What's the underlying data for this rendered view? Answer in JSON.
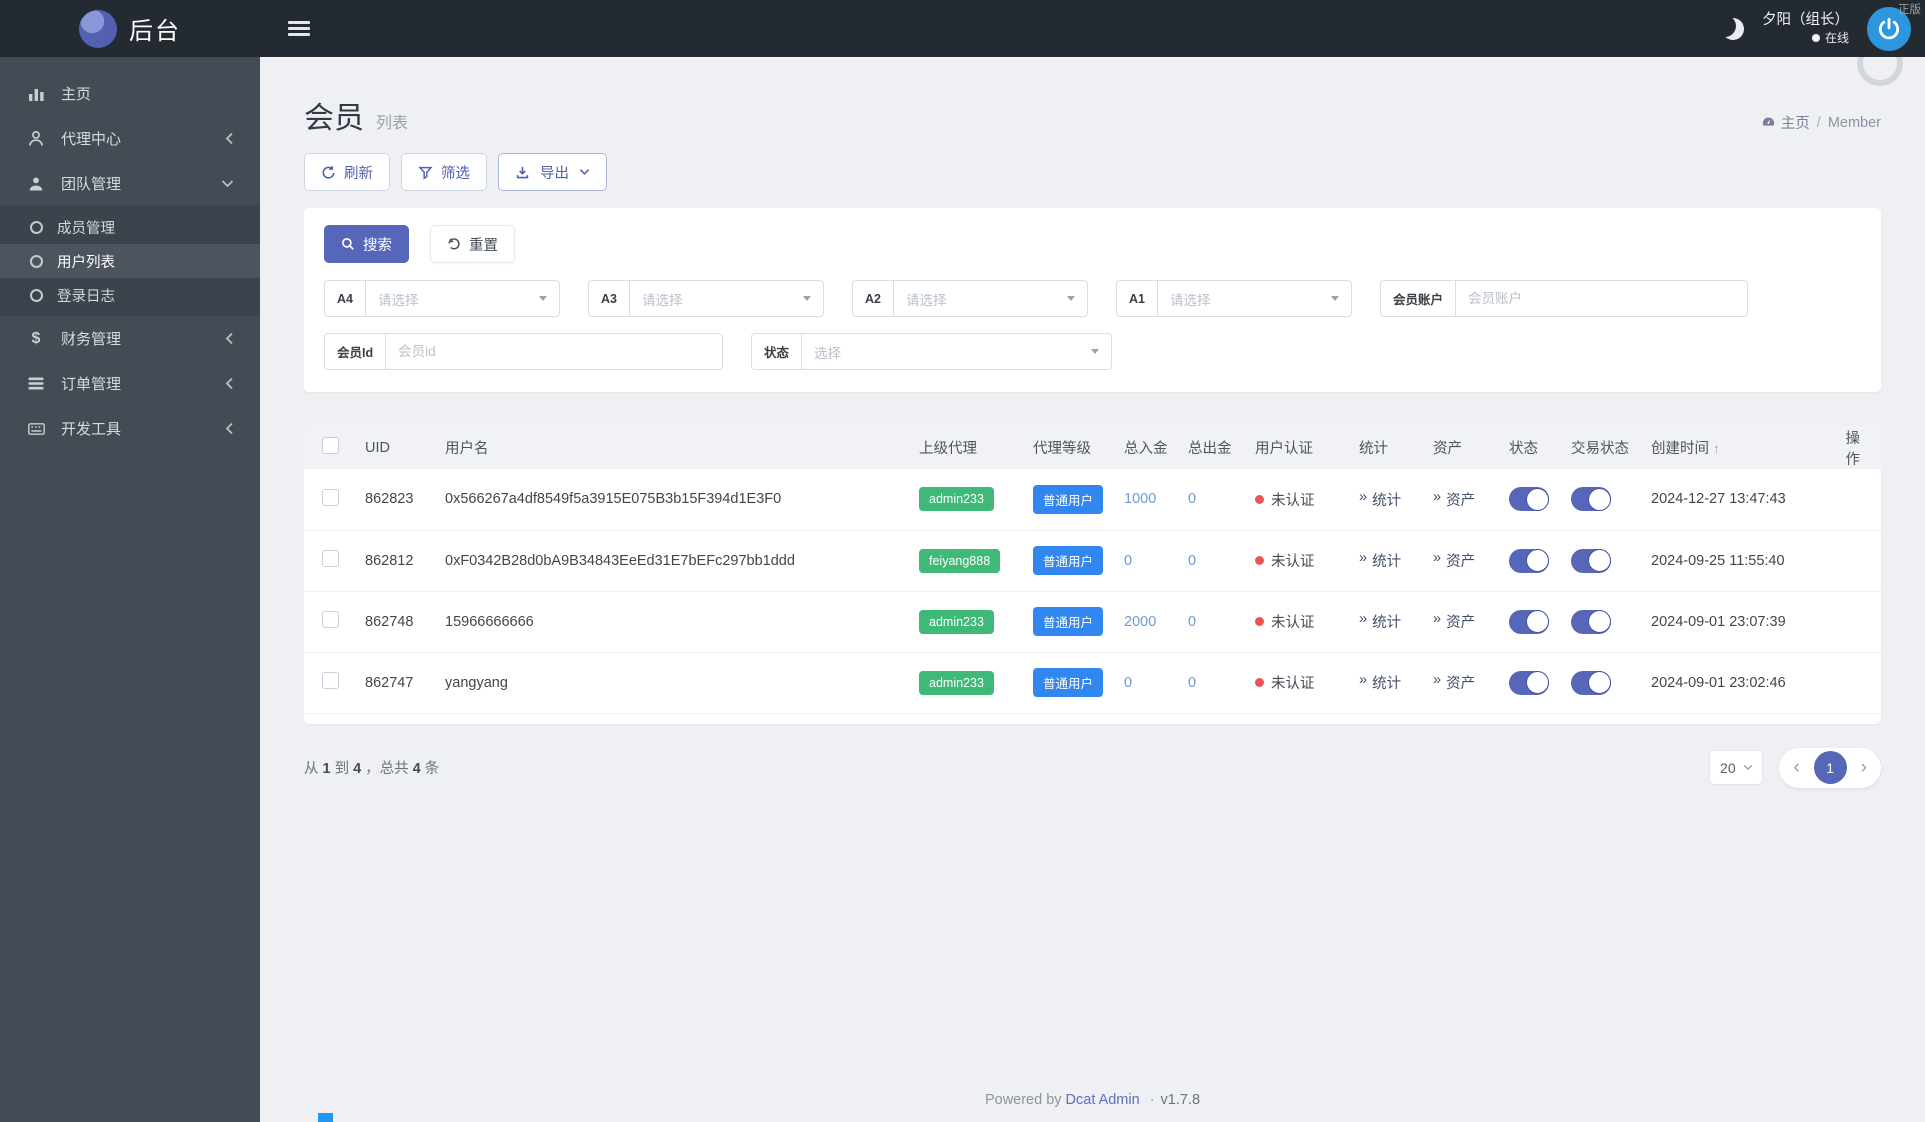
{
  "brand": {
    "title": "后台"
  },
  "watermark": "正版",
  "navbar": {
    "user_name": "夕阳（组长）",
    "online": "在线"
  },
  "sidebar": {
    "items": [
      {
        "label": "主页",
        "icon": "bar-chart-icon"
      },
      {
        "label": "代理中心",
        "icon": "user-icon"
      },
      {
        "label": "团队管理",
        "icon": "team-icon",
        "children": [
          {
            "label": "成员管理"
          },
          {
            "label": "用户列表",
            "active": true
          },
          {
            "label": "登录日志"
          }
        ]
      },
      {
        "label": "财务管理",
        "icon": "dollar-icon",
        "dollar_glyph": "$"
      },
      {
        "label": "订单管理",
        "icon": "orders-icon"
      },
      {
        "label": "开发工具",
        "icon": "keyboard-icon"
      }
    ]
  },
  "page": {
    "title": "会员",
    "subtitle": "列表"
  },
  "breadcrumb": {
    "home": "主页",
    "separator": "/",
    "current": "Member"
  },
  "toolbar": {
    "refresh": "刷新",
    "filter": "筛选",
    "export": "导出"
  },
  "filters": {
    "search": "搜索",
    "reset": "重置",
    "fields": [
      {
        "label": "A4",
        "placeholder": "请选择"
      },
      {
        "label": "A3",
        "placeholder": "请选择"
      },
      {
        "label": "A2",
        "placeholder": "请选择"
      },
      {
        "label": "A1",
        "placeholder": "请选择"
      },
      {
        "label": "会员账户",
        "placeholder": "会员账户"
      },
      {
        "label": "会员Id",
        "placeholder": "会员id"
      },
      {
        "label": "状态",
        "placeholder": "选择"
      }
    ]
  },
  "table": {
    "headers": [
      "UID",
      "用户名",
      "上级代理",
      "代理等级",
      "总入金",
      "总出金",
      "用户认证",
      "统计",
      "资产",
      "状态",
      "交易状态",
      "创建时间",
      "操作"
    ],
    "sort_arrow": "↑",
    "link_prefix": "»",
    "stats_link": "统计",
    "assets_link": "资产",
    "rows": [
      {
        "uid": "862823",
        "username": "0x566267a4df8549f5a3915E075B3b15F394d1E3F0",
        "parent": "admin233",
        "level": "普通用户",
        "total_in": "1000",
        "total_out": "0",
        "auth": "未认证",
        "created": "2024-12-27 13:47:43"
      },
      {
        "uid": "862812",
        "username": "0xF0342B28d0bA9B34843EeEd31E7bEFc297bb1ddd",
        "parent": "feiyang888",
        "level": "普通用户",
        "total_in": "0",
        "total_out": "0",
        "auth": "未认证",
        "created": "2024-09-25 11:55:40"
      },
      {
        "uid": "862748",
        "username": "15966666666",
        "parent": "admin233",
        "level": "普通用户",
        "total_in": "2000",
        "total_out": "0",
        "auth": "未认证",
        "created": "2024-09-01 23:07:39"
      },
      {
        "uid": "862747",
        "username": "yangyang",
        "parent": "admin233",
        "level": "普通用户",
        "total_in": "0",
        "total_out": "0",
        "auth": "未认证",
        "created": "2024-09-01 23:02:46"
      }
    ]
  },
  "pagination": {
    "p1": "从",
    "from": "1",
    "p2": "到",
    "to": "4",
    "p3": "，总共",
    "total": "4",
    "p4": "条",
    "page_size": "20",
    "current": "1",
    "prev": "‹",
    "next": "›"
  },
  "footer": {
    "powered": "Powered by",
    "brand": "Dcat Admin",
    "dot": "·",
    "version": "v1.7.8"
  },
  "colors": {
    "primary": "#5666b8",
    "success": "#3eb978",
    "info": "#3187ef",
    "danger": "#ea5455",
    "navbar": "#242a31",
    "sidebar": "#434b55"
  }
}
